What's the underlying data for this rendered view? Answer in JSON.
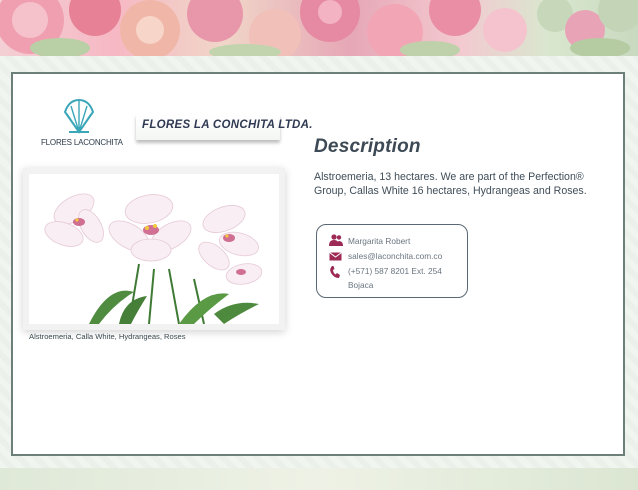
{
  "banner": {
    "description": ""
  },
  "company": {
    "logo_text": "FLORES LACONCHITA",
    "name": "FLORES LA CONCHITA LTDA."
  },
  "photo": {
    "caption": "Alstroemeria, Calla White, Hydrangeas, Roses"
  },
  "description": {
    "title": "Description",
    "body": "Alstroemeria, 13 hectares. We are part of the Perfection® Group, Callas White 16 hectares, Hydrangeas and Roses."
  },
  "contact": {
    "name": "Margarita Robert",
    "email": "sales@laconchita.com.co",
    "phone": "(+571) 587 8201 Ext. 254",
    "city": "Bojaca",
    "icons": [
      "people-icon",
      "mail-icon",
      "phone-icon"
    ]
  },
  "colors": {
    "frame": "#6c7f78",
    "title": "#3d4a55",
    "logo": "#3aa6b8"
  }
}
